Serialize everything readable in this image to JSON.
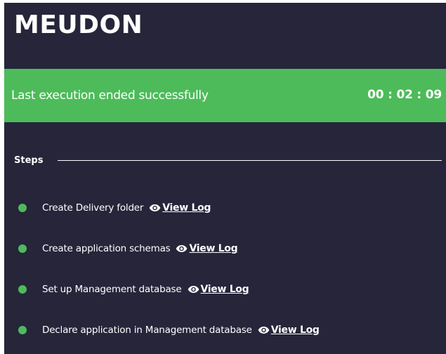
{
  "app": {
    "title": "MEUDON"
  },
  "status": {
    "message": "Last execution ended successfully",
    "elapsed": "00 : 02 : 09",
    "color": "#4dbb5a"
  },
  "steps": {
    "header": "Steps",
    "view_log_label": "View Log",
    "view_log_icon": "eye-icon",
    "items": [
      {
        "label": "Create Delivery folder",
        "status": "success"
      },
      {
        "label": "Create application schemas",
        "status": "success"
      },
      {
        "label": "Set up Management database",
        "status": "success"
      },
      {
        "label": "Declare application in Management database",
        "status": "success"
      }
    ]
  },
  "colors": {
    "background": "#26253a",
    "success": "#4dbb5a",
    "text": "#ffffff"
  }
}
